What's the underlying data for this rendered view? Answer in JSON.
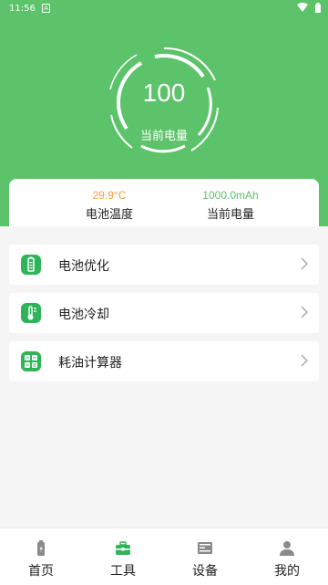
{
  "status_bar": {
    "time": "11:56",
    "notification": "A"
  },
  "gauge": {
    "value": "100",
    "label": "当前电量"
  },
  "stats": {
    "temperature": {
      "value": "29.9°C",
      "label": "电池温度"
    },
    "capacity": {
      "value": "1000.0mAh",
      "label": "当前电量"
    }
  },
  "menu": [
    {
      "label": "电池优化",
      "icon": "battery-icon"
    },
    {
      "label": "电池冷却",
      "icon": "thermometer-icon"
    },
    {
      "label": "耗油计算器",
      "icon": "calculator-icon"
    }
  ],
  "tabs": [
    {
      "label": "首页",
      "icon": "battery-tab-icon"
    },
    {
      "label": "工具",
      "icon": "toolbox-icon"
    },
    {
      "label": "设备",
      "icon": "device-icon"
    },
    {
      "label": "我的",
      "icon": "user-icon"
    }
  ],
  "colors": {
    "brand": "#5cc36a",
    "accent_green": "#2fb45a",
    "warning": "#f0a03c"
  }
}
